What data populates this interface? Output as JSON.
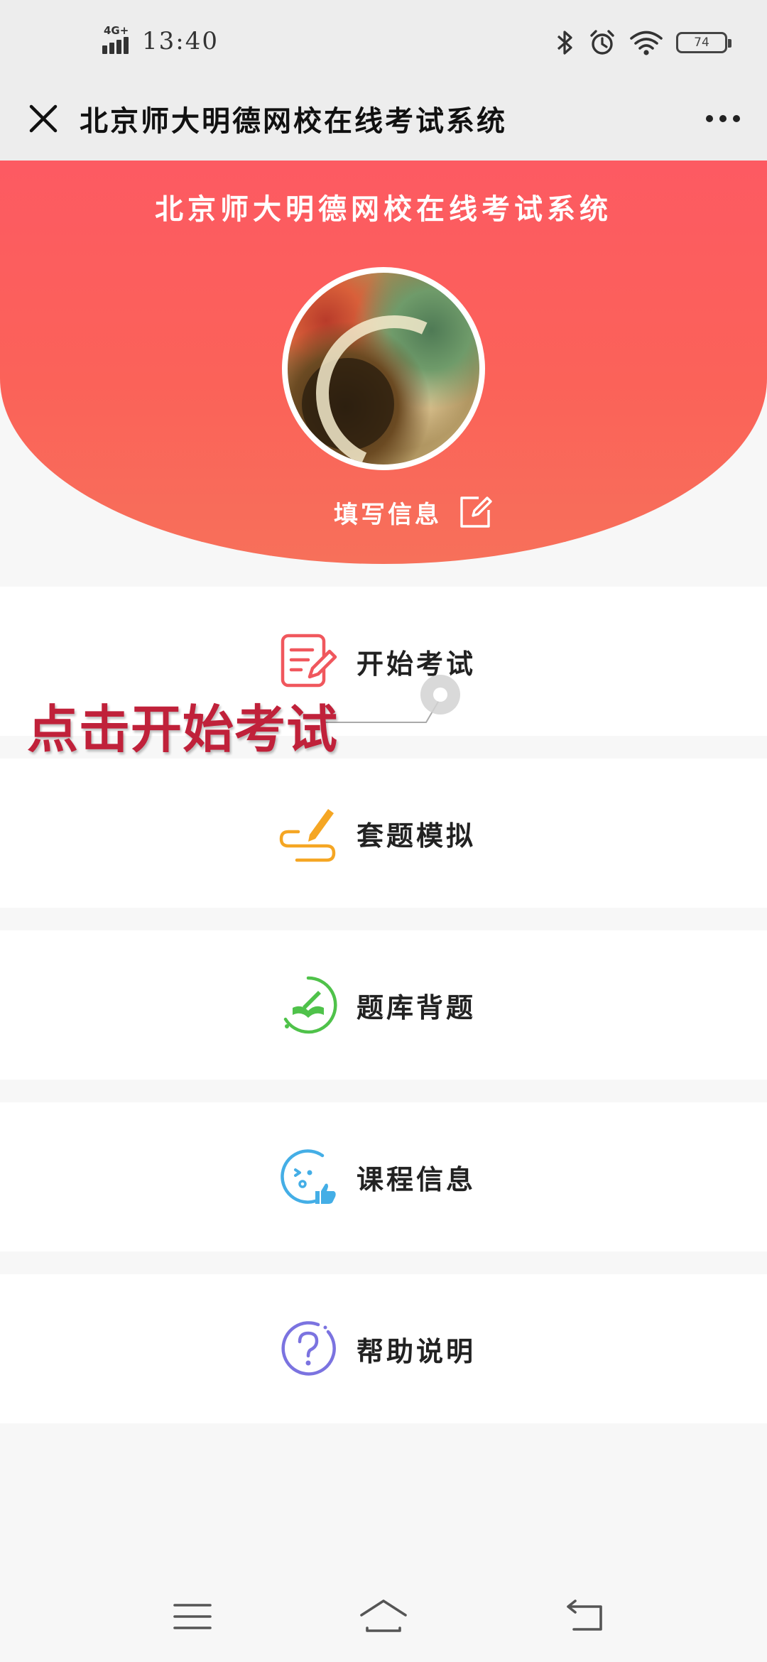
{
  "status_bar": {
    "network": "4G+",
    "time": "13:40",
    "battery": "74"
  },
  "title_bar": {
    "title": "北京师大明德网校在线考试系统"
  },
  "header": {
    "title": "北京师大明德网校在线考试系统",
    "fill_info_label": "填写信息"
  },
  "menu": {
    "items": [
      {
        "label": "开始考试",
        "icon": "exam-edit-icon",
        "color": "#f0575d"
      },
      {
        "label": "套题模拟",
        "icon": "pen-icon",
        "color": "#f5a623"
      },
      {
        "label": "题库背题",
        "icon": "book-icon",
        "color": "#4fc24a"
      },
      {
        "label": "课程信息",
        "icon": "face-thumb-icon",
        "color": "#44aee6"
      },
      {
        "label": "帮助说明",
        "icon": "help-icon",
        "color": "#7b73e0"
      }
    ]
  },
  "annotation": {
    "text": "点击开始考试",
    "color": "#c0213a"
  },
  "theme": {
    "header_red": "#fd5a62",
    "header_orange": "#f7705a"
  }
}
